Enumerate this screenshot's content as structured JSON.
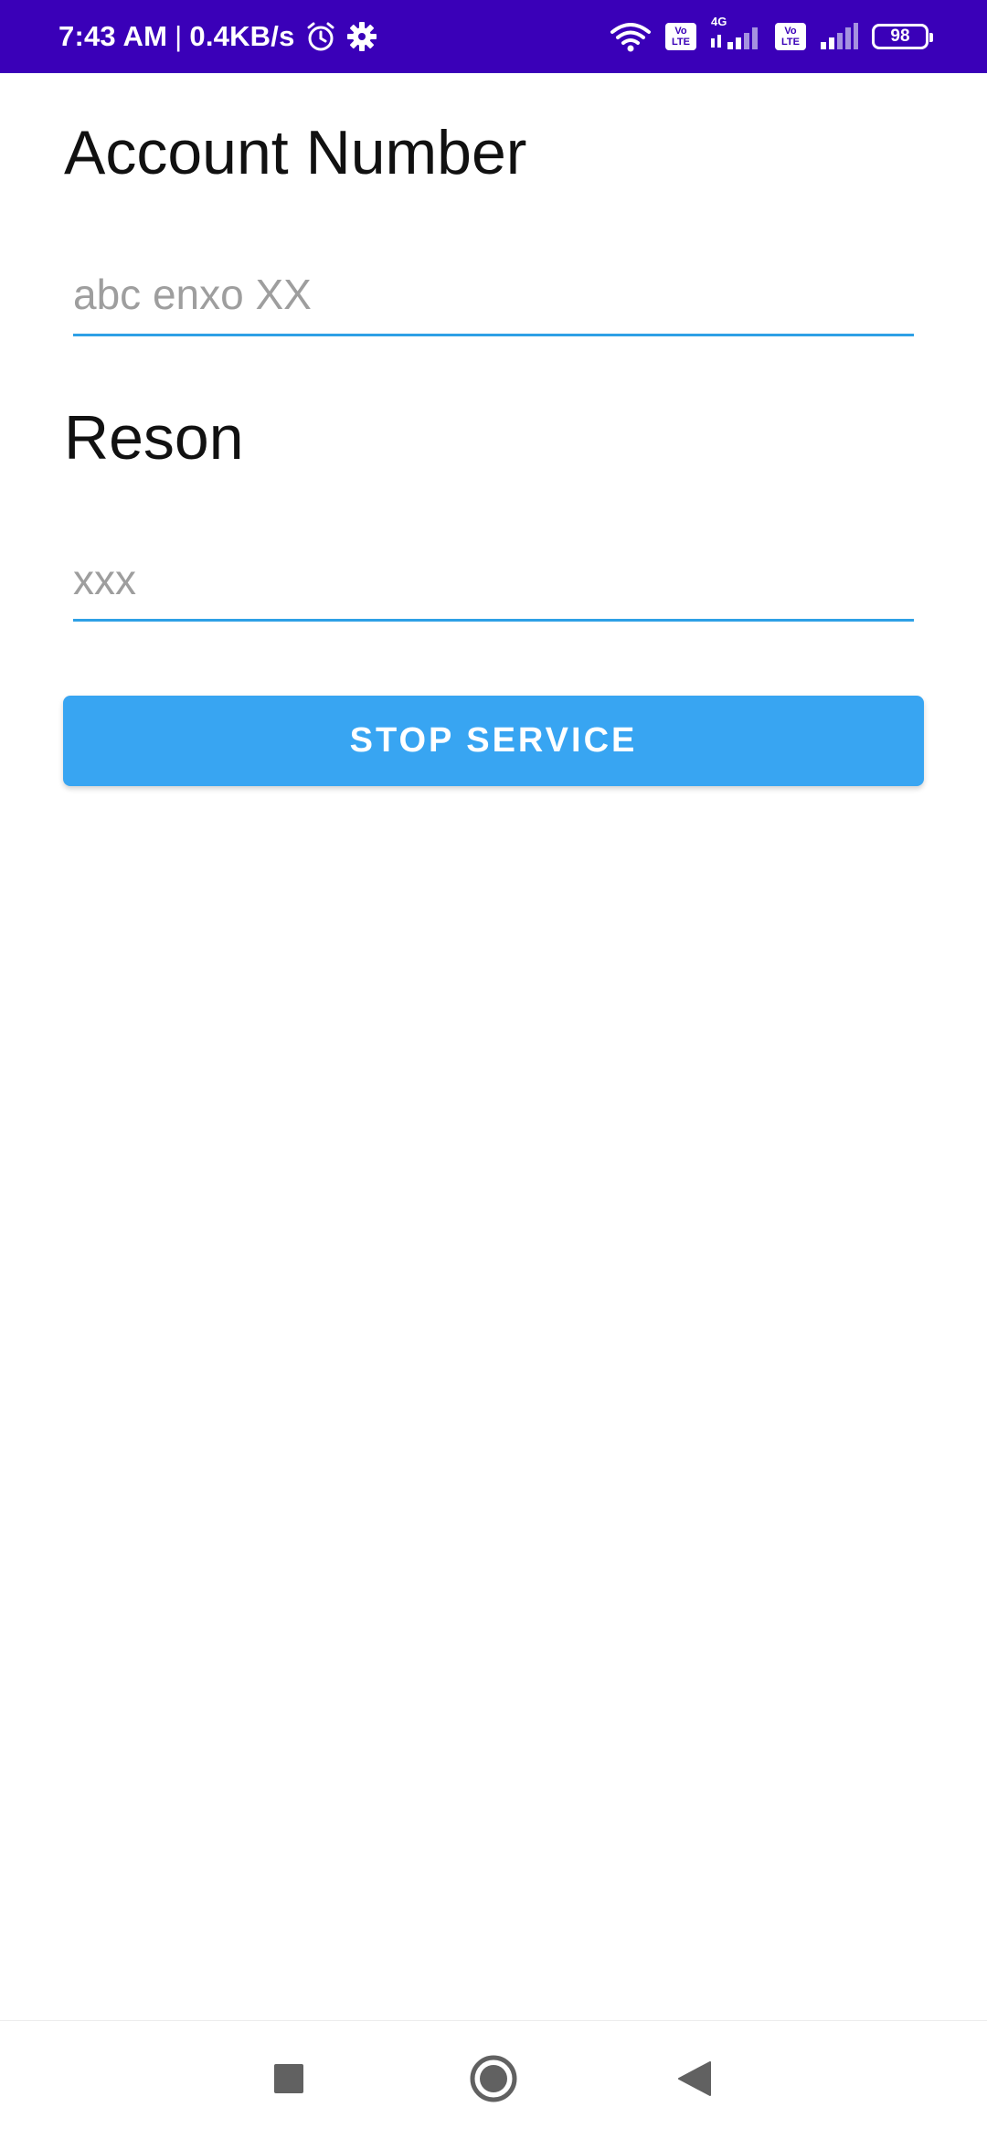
{
  "status_bar": {
    "time": "7:43 AM",
    "separator": "|",
    "network_speed": "0.4KB/s",
    "icons_left": [
      "alarm-icon",
      "settings-gear-icon"
    ],
    "icons_right": [
      "wifi-icon",
      "volte-icon",
      "signal-4g-icon",
      "volte-icon",
      "signal-icon",
      "battery-icon"
    ],
    "volte_top": "Vo",
    "volte_bottom": "LTE",
    "network_type": "4G",
    "battery_level": "98",
    "background_color": "#3a00b8"
  },
  "form": {
    "account_label": "Account Number",
    "account_placeholder": "abc enxo XX",
    "reason_label": "Reson",
    "reason_placeholder": "xxx",
    "submit_label": "STOP SERVICE",
    "accent_color": "#2ea0e6",
    "button_color": "#38a5f2"
  },
  "nav_bar": {
    "icons": [
      "recents-square-icon",
      "home-circle-icon",
      "back-triangle-icon"
    ],
    "icon_color": "#616161"
  }
}
